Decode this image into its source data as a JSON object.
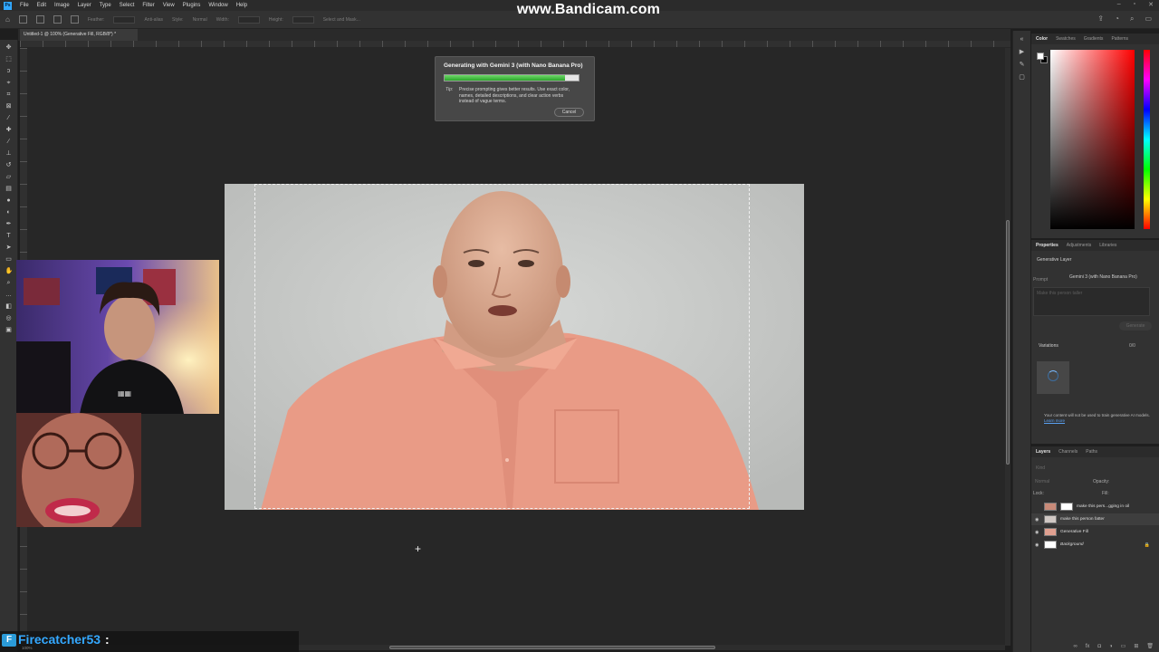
{
  "watermark": "www.Bandicam.com",
  "menu": [
    "File",
    "Edit",
    "Image",
    "Layer",
    "Type",
    "Select",
    "Filter",
    "View",
    "Plugins",
    "Window",
    "Help"
  ],
  "options": {
    "feather": "Feather:",
    "antialias": "Anti-alias",
    "style": "Style:",
    "style_value": "Normal",
    "width": "Width:",
    "height": "Height:",
    "select_mask": "Select and Mask..."
  },
  "document_tab": "Untitled-1 @ 100% (Generative Fill, RGB/8*) *",
  "dialog": {
    "title": "Generating with Gemini 3 (with Nano Banana Pro)",
    "progress": 0.9,
    "tip_label": "Tip:",
    "tip_text": "Precise prompting gives better results. Use exact color, names, detailed descriptions, and clear action verbs instead of vague terms.",
    "cancel": "Cancel"
  },
  "color_panel": {
    "tabs": [
      "Color",
      "Swatches",
      "Gradients",
      "Patterns"
    ]
  },
  "properties_panel": {
    "tabs": [
      "Properties",
      "Adjustments",
      "Libraries"
    ],
    "layer_type": "Generative Layer",
    "prompt_label": "Prompt",
    "model": "Gemini 3 (with Nano Banana Pro)",
    "prompt_placeholder": "Make this person taller",
    "generate": "Generate",
    "variations_label": "Variations",
    "variations_count": "0/0",
    "notice": "Your content will not be used to train generative AI models.",
    "learn_more": "Learn more"
  },
  "layers_panel": {
    "tabs": [
      "Layers",
      "Channels",
      "Paths"
    ],
    "kind": "Kind",
    "blend_mode": "Normal",
    "opacity_label": "Opacity:",
    "lock_label": "Lock:",
    "fill_label": "Fill:",
    "layers": [
      {
        "name": "make this pers...gging in oil",
        "selected": false
      },
      {
        "name": "make this person fatter",
        "selected": true
      },
      {
        "name": "Generative Fill",
        "selected": false
      },
      {
        "name": "Background",
        "selected": false
      }
    ]
  },
  "status": {
    "zoom": "100%"
  },
  "streamer": {
    "logo": "F",
    "name": "Firecatcher53",
    "separator": ":"
  },
  "colors": {
    "accent": "#31a8ff",
    "canvas_bg": "#272727",
    "progress_green": "#2aa52a"
  }
}
